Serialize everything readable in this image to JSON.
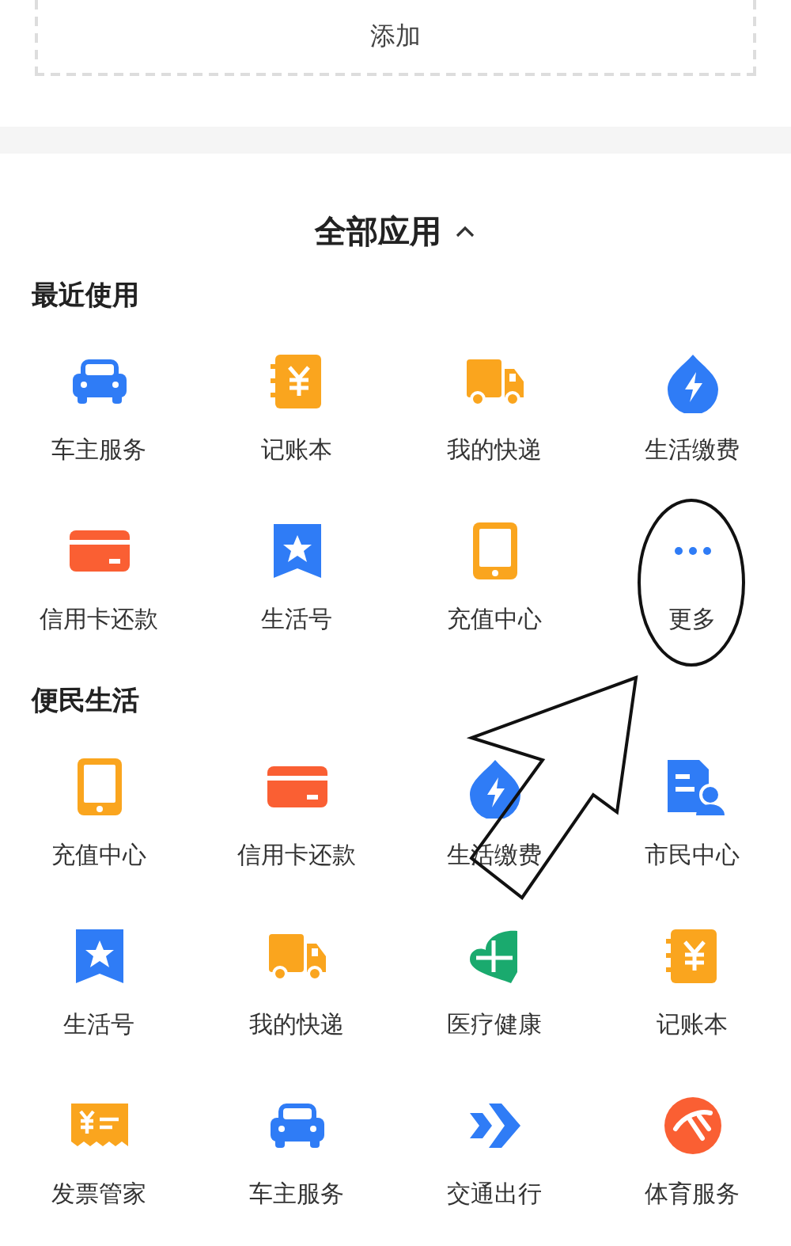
{
  "add_box": {
    "label": "添加"
  },
  "header": {
    "title": "全部应用",
    "expanded": true
  },
  "sections": [
    {
      "title": "最近使用",
      "apps": [
        {
          "label": "车主服务",
          "kind": "car"
        },
        {
          "label": "记账本",
          "kind": "ledger"
        },
        {
          "label": "我的快递",
          "kind": "truck"
        },
        {
          "label": "生活缴费",
          "kind": "drop"
        },
        {
          "label": "信用卡还款",
          "kind": "card"
        },
        {
          "label": "生活号",
          "kind": "bookmark"
        },
        {
          "label": "充值中心",
          "kind": "tablet"
        },
        {
          "label": "更多",
          "kind": "more"
        }
      ]
    },
    {
      "title": "便民生活",
      "apps": [
        {
          "label": "充值中心",
          "kind": "tablet"
        },
        {
          "label": "信用卡还款",
          "kind": "card"
        },
        {
          "label": "生活缴费",
          "kind": "drop"
        },
        {
          "label": "市民中心",
          "kind": "citizen"
        },
        {
          "label": "生活号",
          "kind": "bookmark"
        },
        {
          "label": "我的快递",
          "kind": "truck"
        },
        {
          "label": "医疗健康",
          "kind": "health"
        },
        {
          "label": "记账本",
          "kind": "ledger"
        },
        {
          "label": "发票管家",
          "kind": "invoice"
        },
        {
          "label": "车主服务",
          "kind": "car"
        },
        {
          "label": "交通出行",
          "kind": "arrows"
        },
        {
          "label": "体育服务",
          "kind": "sports"
        }
      ]
    }
  ]
}
